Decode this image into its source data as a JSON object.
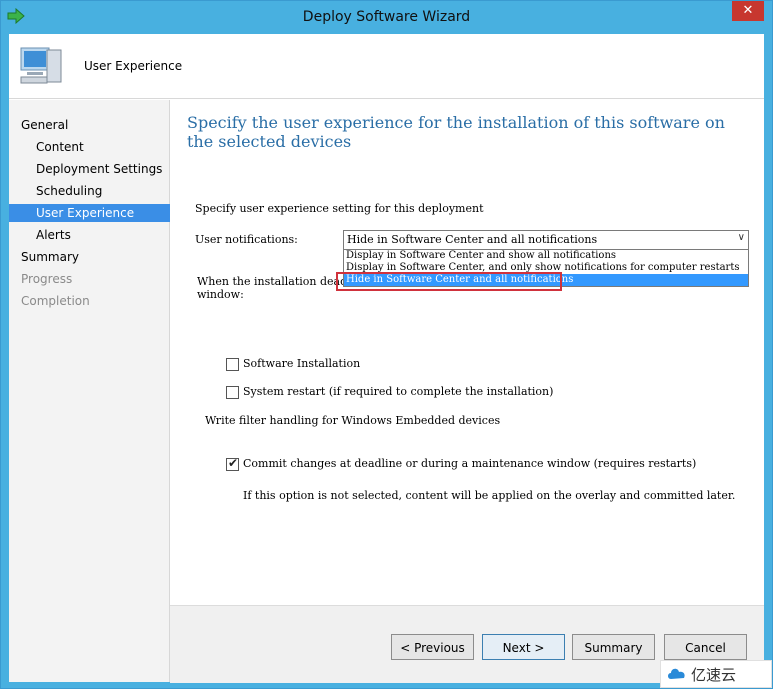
{
  "window": {
    "title": "Deploy Software Wizard",
    "close_label": "✕"
  },
  "header": {
    "page_name": "User Experience"
  },
  "nav": {
    "items": [
      {
        "label": "General"
      },
      {
        "label": "Content"
      },
      {
        "label": "Deployment Settings"
      },
      {
        "label": "Scheduling"
      },
      {
        "label": "User Experience"
      },
      {
        "label": "Alerts"
      },
      {
        "label": "Summary"
      },
      {
        "label": "Progress"
      },
      {
        "label": "Completion"
      }
    ],
    "selected": "User Experience"
  },
  "main": {
    "heading": "Specify the user experience for the installation of this software on the selected devices",
    "section_label": "Specify user experience setting for this deployment",
    "notifications_label": "User notifications:",
    "notifications_value": "Hide in Software Center and all notifications",
    "notifications_options": [
      "Display in Software Center and show all notifications",
      "Display in Software Center, and only show notifications for computer restarts",
      "Hide in Software Center and all notifications"
    ],
    "deadline_label_line1": "When the installation deadline",
    "deadline_label_line2": "window:",
    "software_install_label": "Software Installation",
    "software_install_checked": false,
    "system_restart_label": "System restart  (if required to complete the installation)",
    "system_restart_checked": false,
    "write_filter_label": "Write filter handling for Windows Embedded devices",
    "commit_label": "Commit changes at deadline or during a maintenance window (requires restarts)",
    "commit_checked": true,
    "commit_note": "If this option is not selected, content will be applied on the overlay and committed later."
  },
  "footer": {
    "previous": "< Previous",
    "next": "Next >",
    "summary": "Summary",
    "cancel": "Cancel"
  },
  "watermark": {
    "text": "亿速云"
  },
  "colors": {
    "title_bar": "#48b0e0",
    "heading": "#2a6ea6",
    "selection": "#3a8ee6",
    "highlight_box": "#d0323c"
  }
}
